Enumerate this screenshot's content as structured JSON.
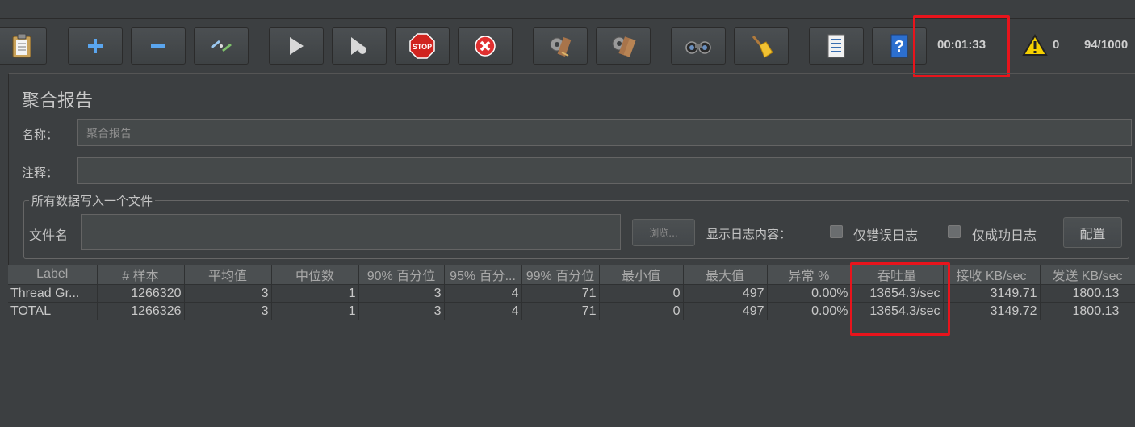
{
  "toolbar": {
    "buttons": [
      {
        "name": "templates-clipboard-icon"
      },
      {
        "name": "add-icon"
      },
      {
        "name": "remove-icon"
      },
      {
        "name": "toggle-icon"
      },
      {
        "name": "start-icon"
      },
      {
        "name": "start-no-pauses-icon"
      },
      {
        "name": "stop-icon"
      },
      {
        "name": "shutdown-icon"
      },
      {
        "name": "clear-icon"
      },
      {
        "name": "clear-all-icon"
      },
      {
        "name": "search-binoculars-icon"
      },
      {
        "name": "reset-search-broom-icon"
      },
      {
        "name": "function-helper-list-icon"
      },
      {
        "name": "help-icon"
      }
    ],
    "elapsed_time": "00:01:33",
    "warning_count": "0",
    "threads": "94/1000"
  },
  "panel": {
    "title": "聚合报告",
    "name_label": "名称：",
    "name_value": "聚合报告",
    "comment_label": "注释：",
    "comment_value": "",
    "file_group_label": "所有数据写入一个文件",
    "filename_label": "文件名",
    "filename_value": "",
    "browse_label": "浏览...",
    "log_content_label": "显示日志内容：",
    "errors_only_label": "仅错误日志",
    "success_only_label": "仅成功日志",
    "config_label": "配置"
  },
  "table": {
    "headers": [
      "Label",
      "# 样本",
      "平均值",
      "中位数",
      "90% 百分位",
      "95% 百分...",
      "99% 百分位",
      "最小值",
      "最大值",
      "异常 %",
      "吞吐量",
      "接收 KB/sec",
      "发送 KB/sec"
    ],
    "rows": [
      [
        "Thread Gr...",
        "1266320",
        "3",
        "1",
        "3",
        "4",
        "71",
        "0",
        "497",
        "0.00%",
        "13654.3/sec",
        "3149.71",
        "1800.13"
      ],
      [
        "TOTAL",
        "1266326",
        "3",
        "1",
        "3",
        "4",
        "71",
        "0",
        "497",
        "0.00%",
        "13654.3/sec",
        "3149.72",
        "1800.13"
      ]
    ]
  }
}
